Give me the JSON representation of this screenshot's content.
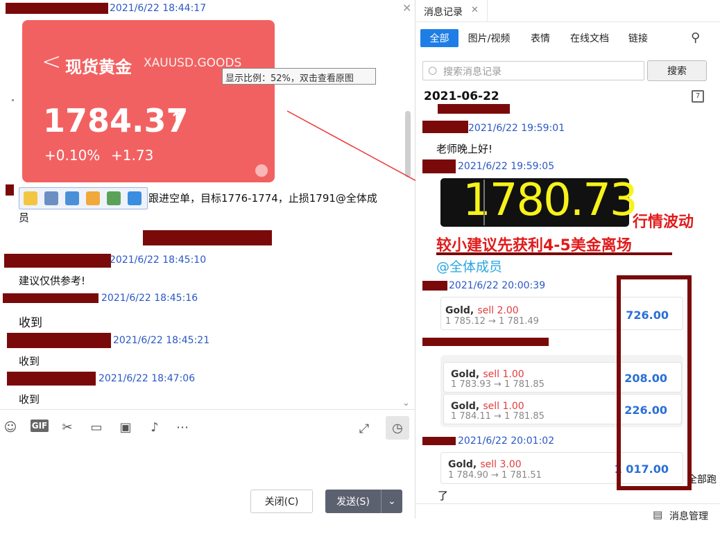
{
  "left": {
    "messages": [
      {
        "time": "2021/6/22 18:44:17"
      },
      {
        "time": "2021/6/22 18:45:10",
        "text": "建议仅供参考!"
      },
      {
        "time": "2021/6/22 18:45:16",
        "text": "收到"
      },
      {
        "time": "2021/6/22 18:45:21",
        "text": "收到"
      },
      {
        "time": "2021/6/22 18:47:06",
        "text": "收到"
      }
    ],
    "gold_card": {
      "back": "<",
      "title": "现货黄金",
      "symbol": "XAUUSD.GOODS",
      "price": "1784.37",
      "arrow": "↑",
      "pct": "+0.10%",
      "change": "+1.73"
    },
    "tooltip": "显示比例：52%，双击查看原图",
    "instruction_line1": "跟进空单，目标1776-1774，止损1791@全体成",
    "instruction_line2": "员",
    "close_label": "关闭(C)",
    "send_label": "发送(S)",
    "send_arrow": "⌄",
    "gif_label": "GIF"
  },
  "right": {
    "tab_title": "消息记录",
    "filters": [
      "全部",
      "图片/视频",
      "表情",
      "在线文档",
      "链接"
    ],
    "search_placeholder": "搜索消息记录",
    "search_button": "搜索",
    "date": "2021-06-22",
    "msg1_time": "2021/6/22 19:59:01",
    "msg1_text": "老师晚上好!",
    "msg2_time": "2021/6/22 19:59:05",
    "big_price": "1780.73",
    "note1": "行情波动",
    "note2": "较小建议先获利4-5美金离场",
    "mention": "@全体成员",
    "msg3_time": "2021/6/22 20:00:39",
    "trade1": {
      "sym": "Gold,",
      "side": "sell 2.00",
      "px": "1 785.12 → 1 781.49",
      "val": "726.00"
    },
    "trade2a": {
      "sym": "Gold,",
      "side": "sell 1.00",
      "px": "1 783.93 → 1 781.85",
      "val": "208.00"
    },
    "trade2b": {
      "sym": "Gold,",
      "side": "sell 1.00",
      "px": "1 784.11 → 1 781.85",
      "val": "226.00"
    },
    "msg5_time": "2021/6/22 20:01:02",
    "trade3": {
      "sym": "Gold,",
      "side": "sell 3.00",
      "px": "1 784.90 → 1 781.51",
      "val": "1 017.00"
    },
    "tail_text": "全部跑",
    "last_text": "了",
    "manage_label": "消息管理"
  },
  "colors": {
    "accent": "#1e7ee6",
    "card_red": "#f26161",
    "redact": "#7a0a0a",
    "timestamp": "#2a57c4",
    "note_red": "#e11b1b",
    "mention": "#2aa6e0"
  }
}
